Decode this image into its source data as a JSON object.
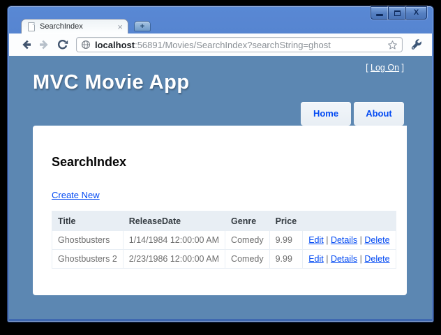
{
  "window": {
    "tab": {
      "title": "SearchIndex",
      "close_glyph": "×"
    },
    "controls": {
      "close_glyph": "X"
    },
    "newtab_glyph": "+"
  },
  "toolbar": {
    "url_host": "localhost",
    "url_rest": ":56891/Movies/SearchIndex?searchString=ghost"
  },
  "page": {
    "logon_open": "[ ",
    "logon_link": "Log On",
    "logon_close": " ]",
    "title": "MVC Movie App",
    "menu": [
      {
        "label": "Home"
      },
      {
        "label": "About"
      }
    ],
    "heading": "SearchIndex",
    "create_link": "Create New"
  },
  "table": {
    "headers": [
      "Title",
      "ReleaseDate",
      "Genre",
      "Price",
      ""
    ],
    "action_sep": "|",
    "rows": [
      {
        "title": "Ghostbusters",
        "release_date": "1/14/1984 12:00:00 AM",
        "genre": "Comedy",
        "price": "9.99",
        "actions": [
          "Edit",
          "Details",
          "Delete"
        ]
      },
      {
        "title": "Ghostbusters 2",
        "release_date": "2/23/1986 12:00:00 AM",
        "genre": "Comedy",
        "price": "9.99",
        "actions": [
          "Edit",
          "Details",
          "Delete"
        ]
      }
    ]
  },
  "colors": {
    "page_background": "#5c87b2",
    "link_blue": "#034af3",
    "table_header_bg": "#e8eef4",
    "titlebar_blue": "#4a77c2",
    "frame_border": "#17336a",
    "body_text": "#6e6e6e"
  }
}
